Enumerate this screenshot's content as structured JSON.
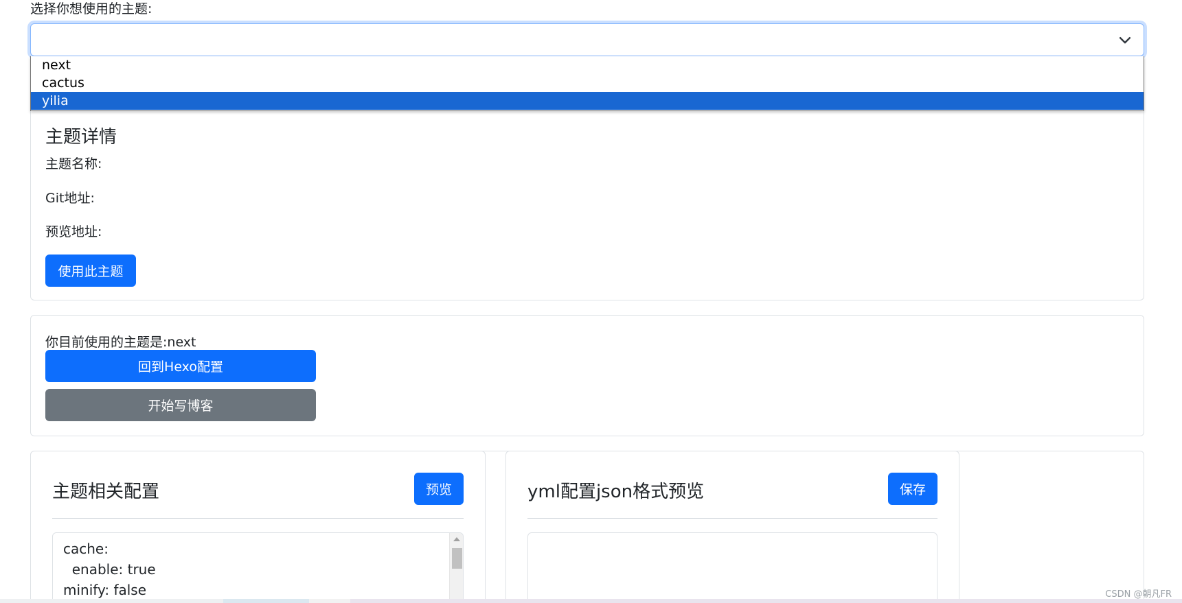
{
  "theme_select": {
    "label": "选择你想使用的主题:",
    "current_value": "",
    "options": [
      "next",
      "cactus",
      "yilia"
    ],
    "highlighted_option": "yilia"
  },
  "theme_detail": {
    "title": "主题详情",
    "name_label": "主题名称:",
    "git_label": "Git地址:",
    "preview_label": "预览地址:",
    "use_button": "使用此主题"
  },
  "current_theme": {
    "text": "你目前使用的主题是:next",
    "back_button": "回到Hexo配置",
    "write_button": "开始写博客"
  },
  "theme_config": {
    "title": "主题相关配置",
    "preview_button": "预览",
    "code_lines": [
      "cache:",
      "  enable: true",
      "minify: false"
    ]
  },
  "json_preview": {
    "title": "yml配置json格式预览",
    "save_button": "保存"
  },
  "watermark": "CSDN @朝凡FR",
  "colors": {
    "primary": "#0d6efd",
    "secondary": "#6c757d",
    "option_highlight": "#1967d2"
  }
}
